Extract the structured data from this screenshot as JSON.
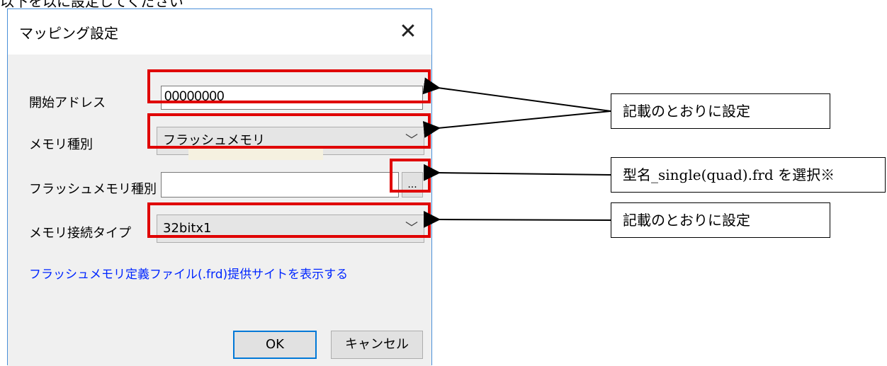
{
  "page_header_partial": "以下を以に設定してください",
  "dialog": {
    "title": "マッピング設定",
    "close_glyph": "✕",
    "fields": {
      "start_address": {
        "label": "開始アドレス",
        "value": "00000000"
      },
      "memory_type": {
        "label": "メモリ種別",
        "value": "フラッシュメモリ"
      },
      "flash_memory_type": {
        "label": "フラッシュメモリ種別",
        "value": "",
        "browse_label": "..."
      },
      "memory_connection_type": {
        "label": "メモリ接続タイプ",
        "value": "32bitx1"
      }
    },
    "link_text": "フラッシュメモリ定義ファイル(.frd)提供サイトを表示する",
    "ok_label": "OK",
    "cancel_label": "キャンセル"
  },
  "callouts": {
    "top": "記載のとおりに設定",
    "middle": "型名_single(quad).frd を選択※",
    "bottom": "記載のとおりに設定"
  },
  "colors": {
    "annotation_red": "#e00000",
    "link_blue": "#0026ff",
    "window_border": "#4a90d9"
  }
}
